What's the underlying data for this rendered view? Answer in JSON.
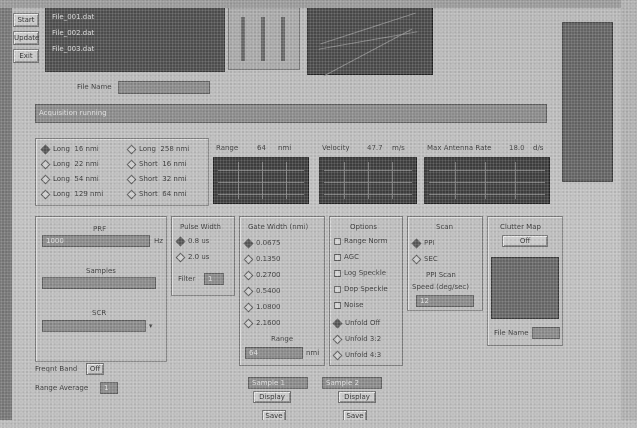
{
  "left_buttons": [
    "Start",
    "Update",
    "Exit"
  ],
  "file_list": [
    "File_001.dat",
    "File_002.dat",
    "File_003.dat"
  ],
  "file_name": {
    "label": "File Name",
    "value": ""
  },
  "status_bar": "Acquisition running",
  "range_modes": [
    {
      "mode": "Long",
      "value": "16 nmi"
    },
    {
      "mode": "Long",
      "value": "22 nmi"
    },
    {
      "mode": "Long",
      "value": "54 nmi"
    },
    {
      "mode": "Long",
      "value": "129 nmi"
    },
    {
      "mode": "Long",
      "value": "258 nmi"
    },
    {
      "mode": "Short",
      "value": "16 nmi"
    },
    {
      "mode": "Short",
      "value": "32 nmi"
    },
    {
      "mode": "Short",
      "value": "64 nmi"
    }
  ],
  "readouts": {
    "range_label": "Range",
    "range_value": "64",
    "range_unit": "nmi",
    "velocity_label": "Velocity",
    "velocity_value": "47.7",
    "velocity_unit": "m/s",
    "max_ant_label": "Max Antenna Rate",
    "max_ant_value": "18.0",
    "max_ant_unit": "d/s"
  },
  "prf": {
    "title": "PRF",
    "unit": "Hz",
    "value": "1000"
  },
  "samples": {
    "title": "Samples",
    "value": ""
  },
  "scr": {
    "title": "SCR",
    "value": ""
  },
  "pulse_width": {
    "title": "Pulse Width",
    "options": [
      "0.8 us",
      "2.0 us"
    ],
    "filter_label": "Filter",
    "filter_value": "1"
  },
  "gate_width": {
    "title": "Gate Width (nmi)",
    "options": [
      "0.0675",
      "0.1350",
      "0.2700",
      "0.5400",
      "1.0800",
      "2.1600"
    ],
    "range_label": "Range",
    "range_value": "64",
    "range_unit": "nmi"
  },
  "options": {
    "title": "Options",
    "checks": [
      "Range Norm",
      "AGC",
      "Log Speckle",
      "Dop Speckle",
      "Noise"
    ],
    "radios": [
      "Unfold Off",
      "Unfold 3:2",
      "Unfold 4:3"
    ]
  },
  "scan": {
    "title": "Scan",
    "options": [
      "PPI",
      "SEC"
    ],
    "ppi_scan_label": "PPI Scan",
    "speed_label": "Speed (deg/sec)",
    "speed_value": "12"
  },
  "clutter_map": {
    "title": "Clutter Map",
    "state": "Off",
    "file_name_label": "File Name",
    "file_name_value": ""
  },
  "bottom_left": {
    "fft_label": "Freqnt Band",
    "fft_value": "Off",
    "range_avg_label": "Range Average",
    "range_avg_value": "1"
  },
  "bottom_buttons": {
    "left_field": "Sample 1",
    "right_field": "Sample 2",
    "display_left": "Display",
    "display_right": "Display",
    "save_left": "Save",
    "save_right": "Save"
  }
}
